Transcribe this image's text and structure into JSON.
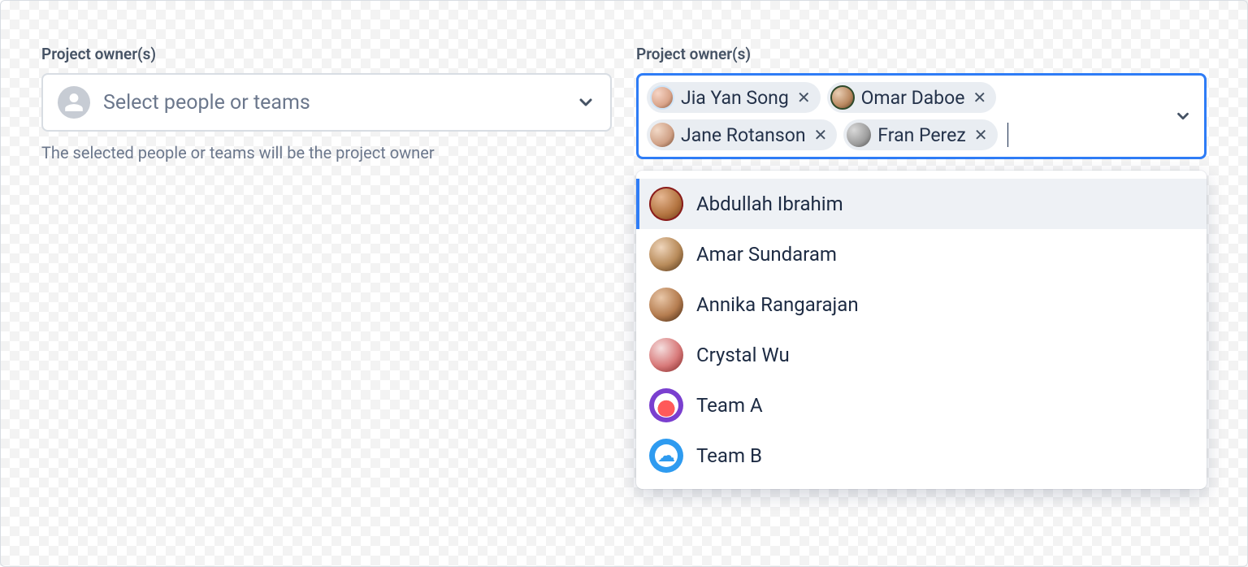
{
  "left": {
    "label": "Project owner(s)",
    "placeholder": "Select people or teams",
    "helper": "The selected people or teams will be the project owner"
  },
  "right": {
    "label": "Project owner(s)",
    "selected": [
      {
        "name": "Jia Yan Song"
      },
      {
        "name": "Omar Daboe"
      },
      {
        "name": "Jane Rotanson"
      },
      {
        "name": "Fran Perez"
      }
    ],
    "options": [
      {
        "name": "Abdullah Ibrahim",
        "highlighted": true
      },
      {
        "name": "Amar Sundaram"
      },
      {
        "name": "Annika Rangarajan"
      },
      {
        "name": "Crystal Wu"
      },
      {
        "name": "Team A"
      },
      {
        "name": "Team B"
      }
    ]
  }
}
